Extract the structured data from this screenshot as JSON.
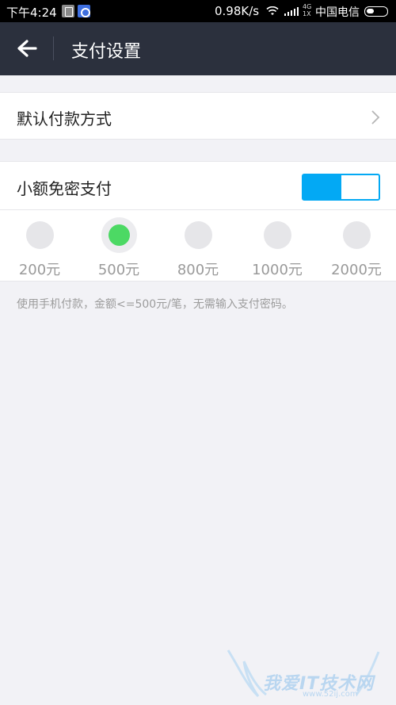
{
  "status_bar": {
    "time": "下午4:24",
    "speed": "0.98K/s",
    "net_top": "4G",
    "net_bottom": "1X",
    "carrier": "中国电信"
  },
  "app_bar": {
    "title": "支付设置"
  },
  "default_payment": {
    "label": "默认付款方式"
  },
  "small_payment": {
    "label": "小额免密支付",
    "enabled": true,
    "amounts": [
      "200元",
      "500元",
      "800元",
      "1000元",
      "2000元"
    ],
    "selected_amount": "500元"
  },
  "hint": "使用手机付款，金额<=500元/笔，无需输入支付密码。",
  "watermark": {
    "text": "我爱IT技术网",
    "url": "www.52ij.com"
  },
  "colors": {
    "app_bar": "#2b303d",
    "accent": "#03a9f4",
    "selected_dot": "#4cd964",
    "background": "#f2f2f6"
  },
  "icons": {
    "back": "arrow-left-icon",
    "chevron": "chevron-right-icon",
    "wifi": "wifi-icon",
    "signal": "signal-icon",
    "battery": "battery-icon"
  }
}
